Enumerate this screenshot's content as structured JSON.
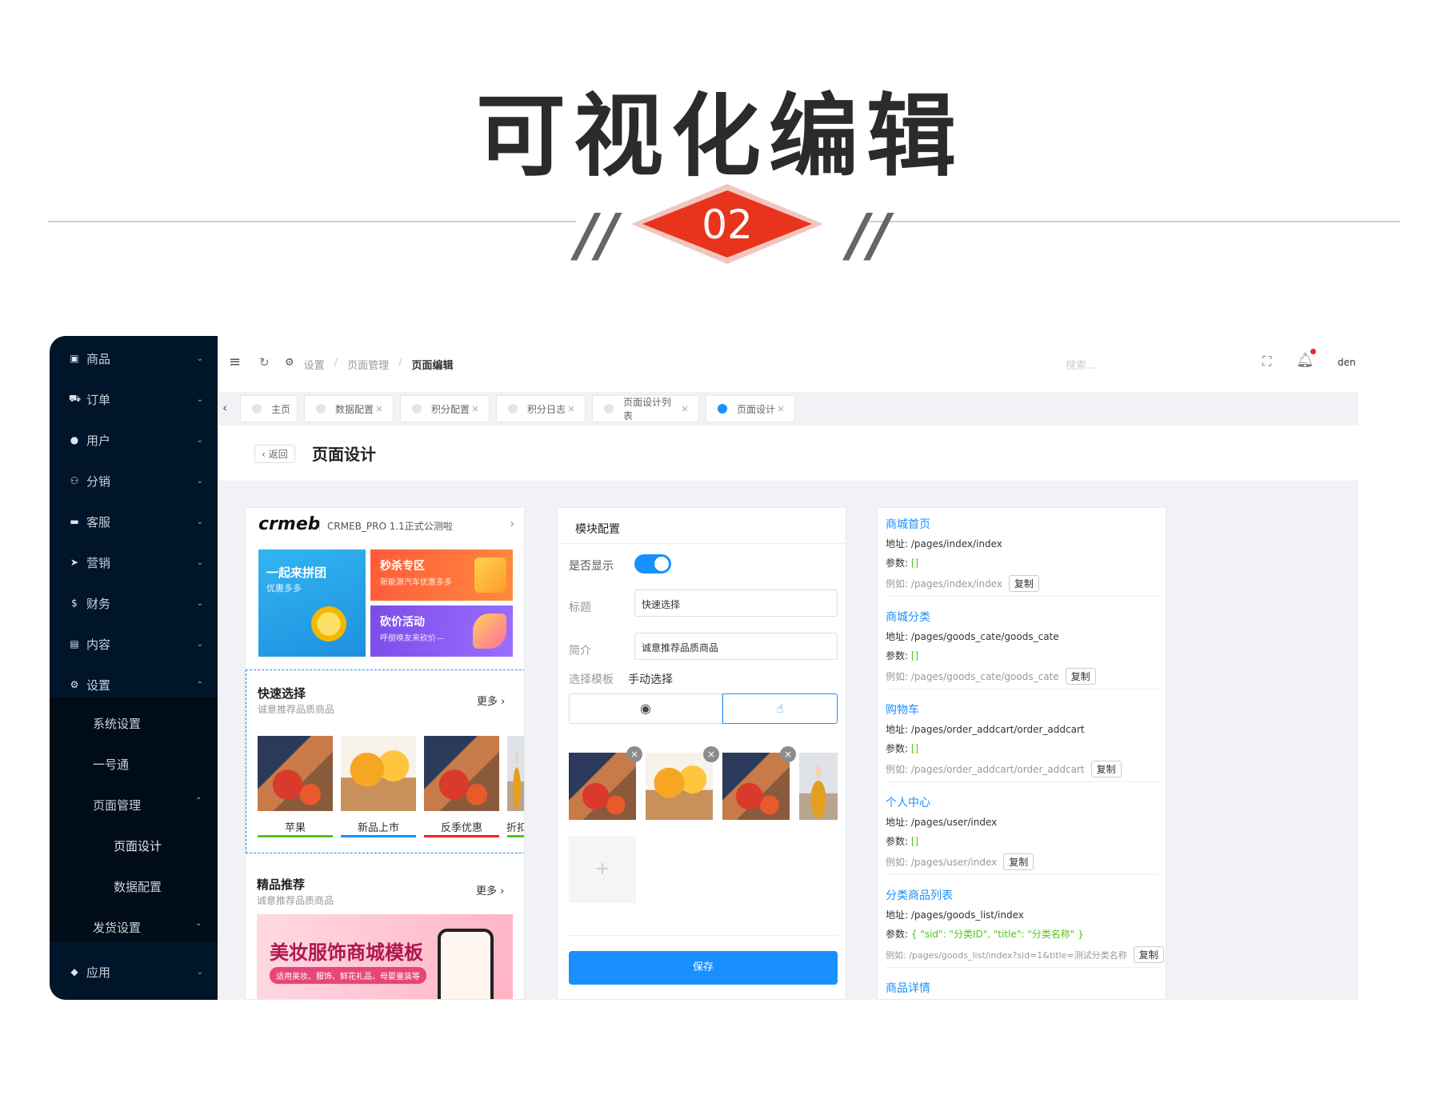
{
  "banner": {
    "title": "可视化编辑",
    "number": "02",
    "quote_mark": "//"
  },
  "sidebar": {
    "items": [
      {
        "label": "商品",
        "icon": "basket-icon"
      },
      {
        "label": "订单",
        "icon": "cart-icon"
      },
      {
        "label": "用户",
        "icon": "user-icon"
      },
      {
        "label": "分销",
        "icon": "group-icon"
      },
      {
        "label": "客服",
        "icon": "chat-icon"
      },
      {
        "label": "营销",
        "icon": "send-icon"
      },
      {
        "label": "财务",
        "icon": "dollar-icon"
      },
      {
        "label": "内容",
        "icon": "book-icon"
      },
      {
        "label": "设置",
        "icon": "gear-icon"
      },
      {
        "label": "应用",
        "icon": "cube-icon"
      }
    ],
    "settings_sub": [
      "系统设置",
      "一号通",
      "页面管理",
      "页面设计",
      "数据配置",
      "发货设置"
    ]
  },
  "topbar": {
    "breadcrumb": [
      "设置",
      "页面管理",
      "页面编辑"
    ],
    "search_placeholder": "搜索...",
    "user": "den"
  },
  "tabs": [
    {
      "label": "主页",
      "active": false
    },
    {
      "label": "数据配置",
      "active": false
    },
    {
      "label": "积分配置",
      "active": false
    },
    {
      "label": "积分日志",
      "active": false
    },
    {
      "label": "页面设计列表",
      "active": false
    },
    {
      "label": "页面设计",
      "active": true
    }
  ],
  "page": {
    "back_label": "返回",
    "title": "页面设计"
  },
  "preview": {
    "logo": "crmeb",
    "notice": "CRMEB_PRO 1.1正式公测啦",
    "promo_big": {
      "title": "一起来拼团",
      "subtitle": "优惠多多"
    },
    "promo_top": {
      "title": "秒杀专区",
      "subtitle": "新能源汽车优惠多多"
    },
    "promo_bottom": {
      "title": "砍价活动",
      "subtitle": "呼朋唤友来砍价—"
    },
    "quick": {
      "title": "快速选择",
      "subtitle": "诚意推荐品质商品",
      "more": "更多 ›",
      "items": [
        "苹果",
        "新品上市",
        "反季优惠",
        "折扣"
      ]
    },
    "recommend": {
      "title": "精品推荐",
      "subtitle": "诚意推荐品质商品",
      "more": "更多 ›",
      "banner_title": "美妆服饰商城模板",
      "banner_sub": "适用美妆、服饰、鲜花礼品、母婴童装等"
    }
  },
  "module": {
    "header": "模块配置",
    "show_label": "是否显示",
    "title_label": "标题",
    "title_value": "快速选择",
    "intro_label": "简介",
    "intro_value": "诚意推荐品质商品",
    "template_label": "选择模板",
    "template_value": "手动选择",
    "add_symbol": "+",
    "save_label": "保存"
  },
  "links": [
    {
      "name": "商城首页",
      "addr": "/pages/index/index",
      "param": "[]",
      "example": "/pages/index/index"
    },
    {
      "name": "商城分类",
      "addr": "/pages/goods_cate/goods_cate",
      "param": "[]",
      "example": "/pages/goods_cate/goods_cate"
    },
    {
      "name": "购物车",
      "addr": "/pages/order_addcart/order_addcart",
      "param": "[]",
      "example": "/pages/order_addcart/order_addcart"
    },
    {
      "name": "个人中心",
      "addr": "/pages/user/index",
      "param": "[]",
      "example": "/pages/user/index"
    },
    {
      "name": "分类商品列表",
      "addr": "/pages/goods_list/index",
      "param": "{ \"sid\": \"分类ID\", \"title\": \"分类名称\" }",
      "example": "/pages/goods_list/index?sid=1&title=测试分类名称"
    },
    {
      "name": "商品详情",
      "addr": "",
      "param": "",
      "example": ""
    }
  ],
  "link_labels": {
    "addr": "地址:",
    "param": "参数:",
    "example": "例如:",
    "copy": "复制"
  },
  "colors": {
    "sidebar": "#001529",
    "accent": "#1890ff",
    "badge": "#e8341c",
    "green": "#52c41a"
  }
}
